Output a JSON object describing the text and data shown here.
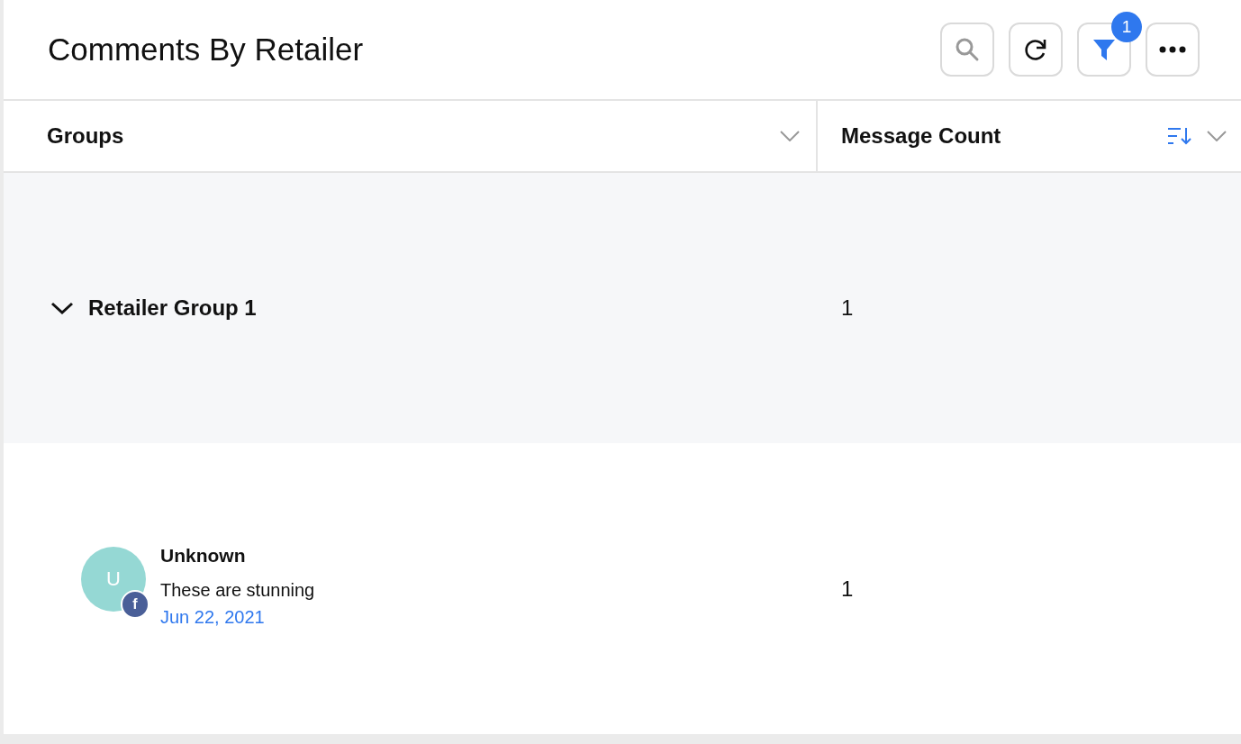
{
  "title": "Comments By Retailer",
  "toolbar": {
    "filter_count": "1"
  },
  "columns": [
    {
      "label": "Groups",
      "sortable": false
    },
    {
      "label": "Message Count",
      "sortable": true
    }
  ],
  "groups": [
    {
      "label": "Retailer Group 1",
      "count": "1",
      "expanded": true,
      "children": [
        {
          "avatar_letter": "U",
          "network_letter": "f",
          "author": "Unknown",
          "text": "These are stunning",
          "date": "Jun 22, 2021",
          "count": "1"
        }
      ]
    }
  ]
}
